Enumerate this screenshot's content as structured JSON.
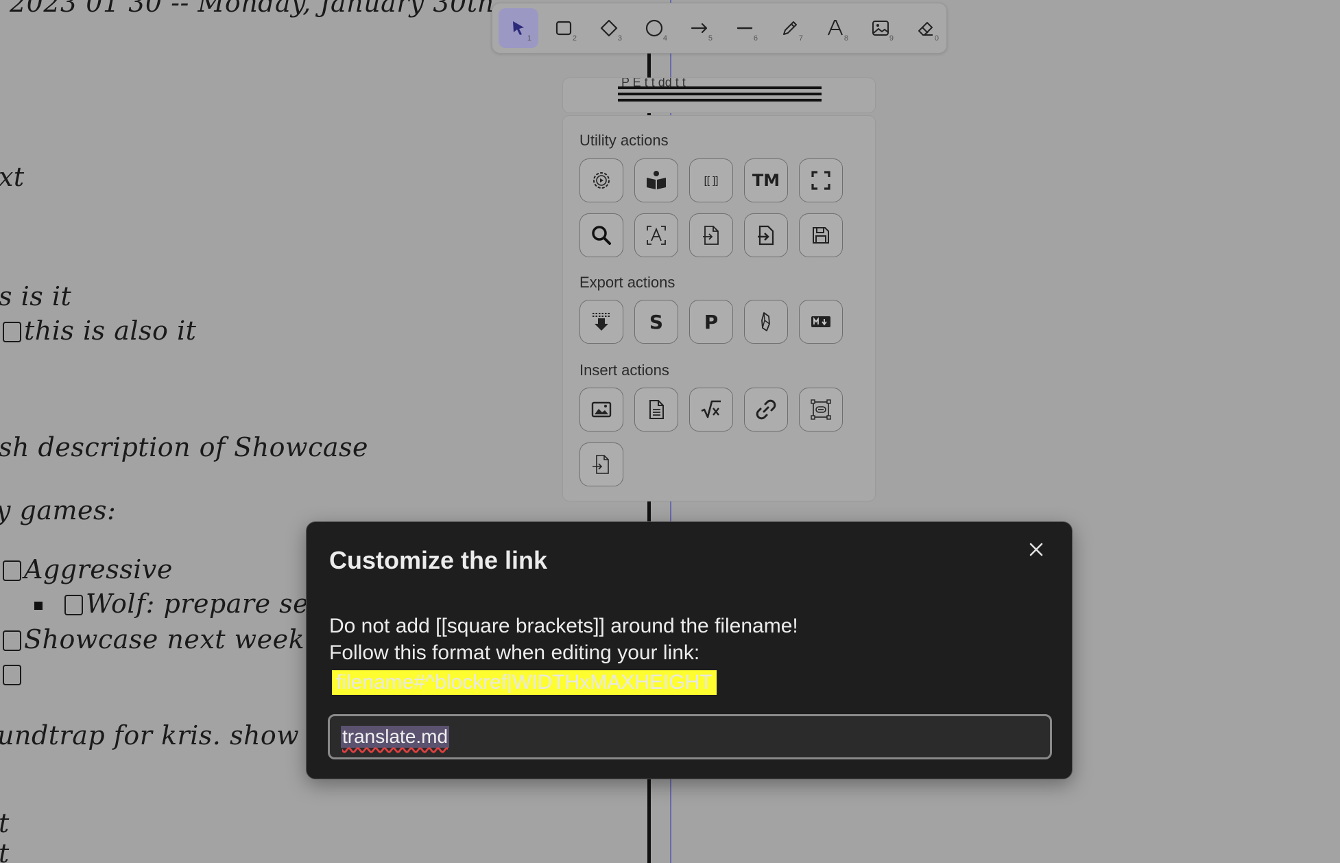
{
  "canvas": {
    "lines": [
      "2023 01 30 -- Monday, January 30th",
      "xt",
      "s is it",
      "this is also it",
      "sh description of Showcase",
      "y games:",
      "Aggressive",
      "Wolf: prepare sec",
      "Showcase next week t",
      "undtrap for kris. show ol",
      "t",
      "t"
    ]
  },
  "toolbar": {
    "tools": [
      {
        "name": "select",
        "num": "1"
      },
      {
        "name": "rectangle",
        "num": "2"
      },
      {
        "name": "diamond",
        "num": "3"
      },
      {
        "name": "ellipse",
        "num": "4"
      },
      {
        "name": "arrow",
        "num": "5"
      },
      {
        "name": "line",
        "num": "6"
      },
      {
        "name": "draw",
        "num": "7"
      },
      {
        "name": "text",
        "num": "8"
      },
      {
        "name": "image",
        "num": "9"
      },
      {
        "name": "eraser",
        "num": "0"
      }
    ]
  },
  "panel": {
    "ghost_text": "P    E   t   t   dd  t  t",
    "utility_title": "Utility actions",
    "export_title": "Export actions",
    "insert_title": "Insert actions",
    "brackets_label": "[[ ]]",
    "tm_label": "TM",
    "s_label": "S",
    "p_label": "P"
  },
  "modal": {
    "title": "Customize the link",
    "line1": "Do not add [[square brackets]] around the filename!",
    "line2": "Follow this format when editing your link:",
    "format": "filename#^blockref|WIDTHxMAXHEIGHT",
    "input_value": "translate.md",
    "highlight_color": "#fdfd2f"
  }
}
